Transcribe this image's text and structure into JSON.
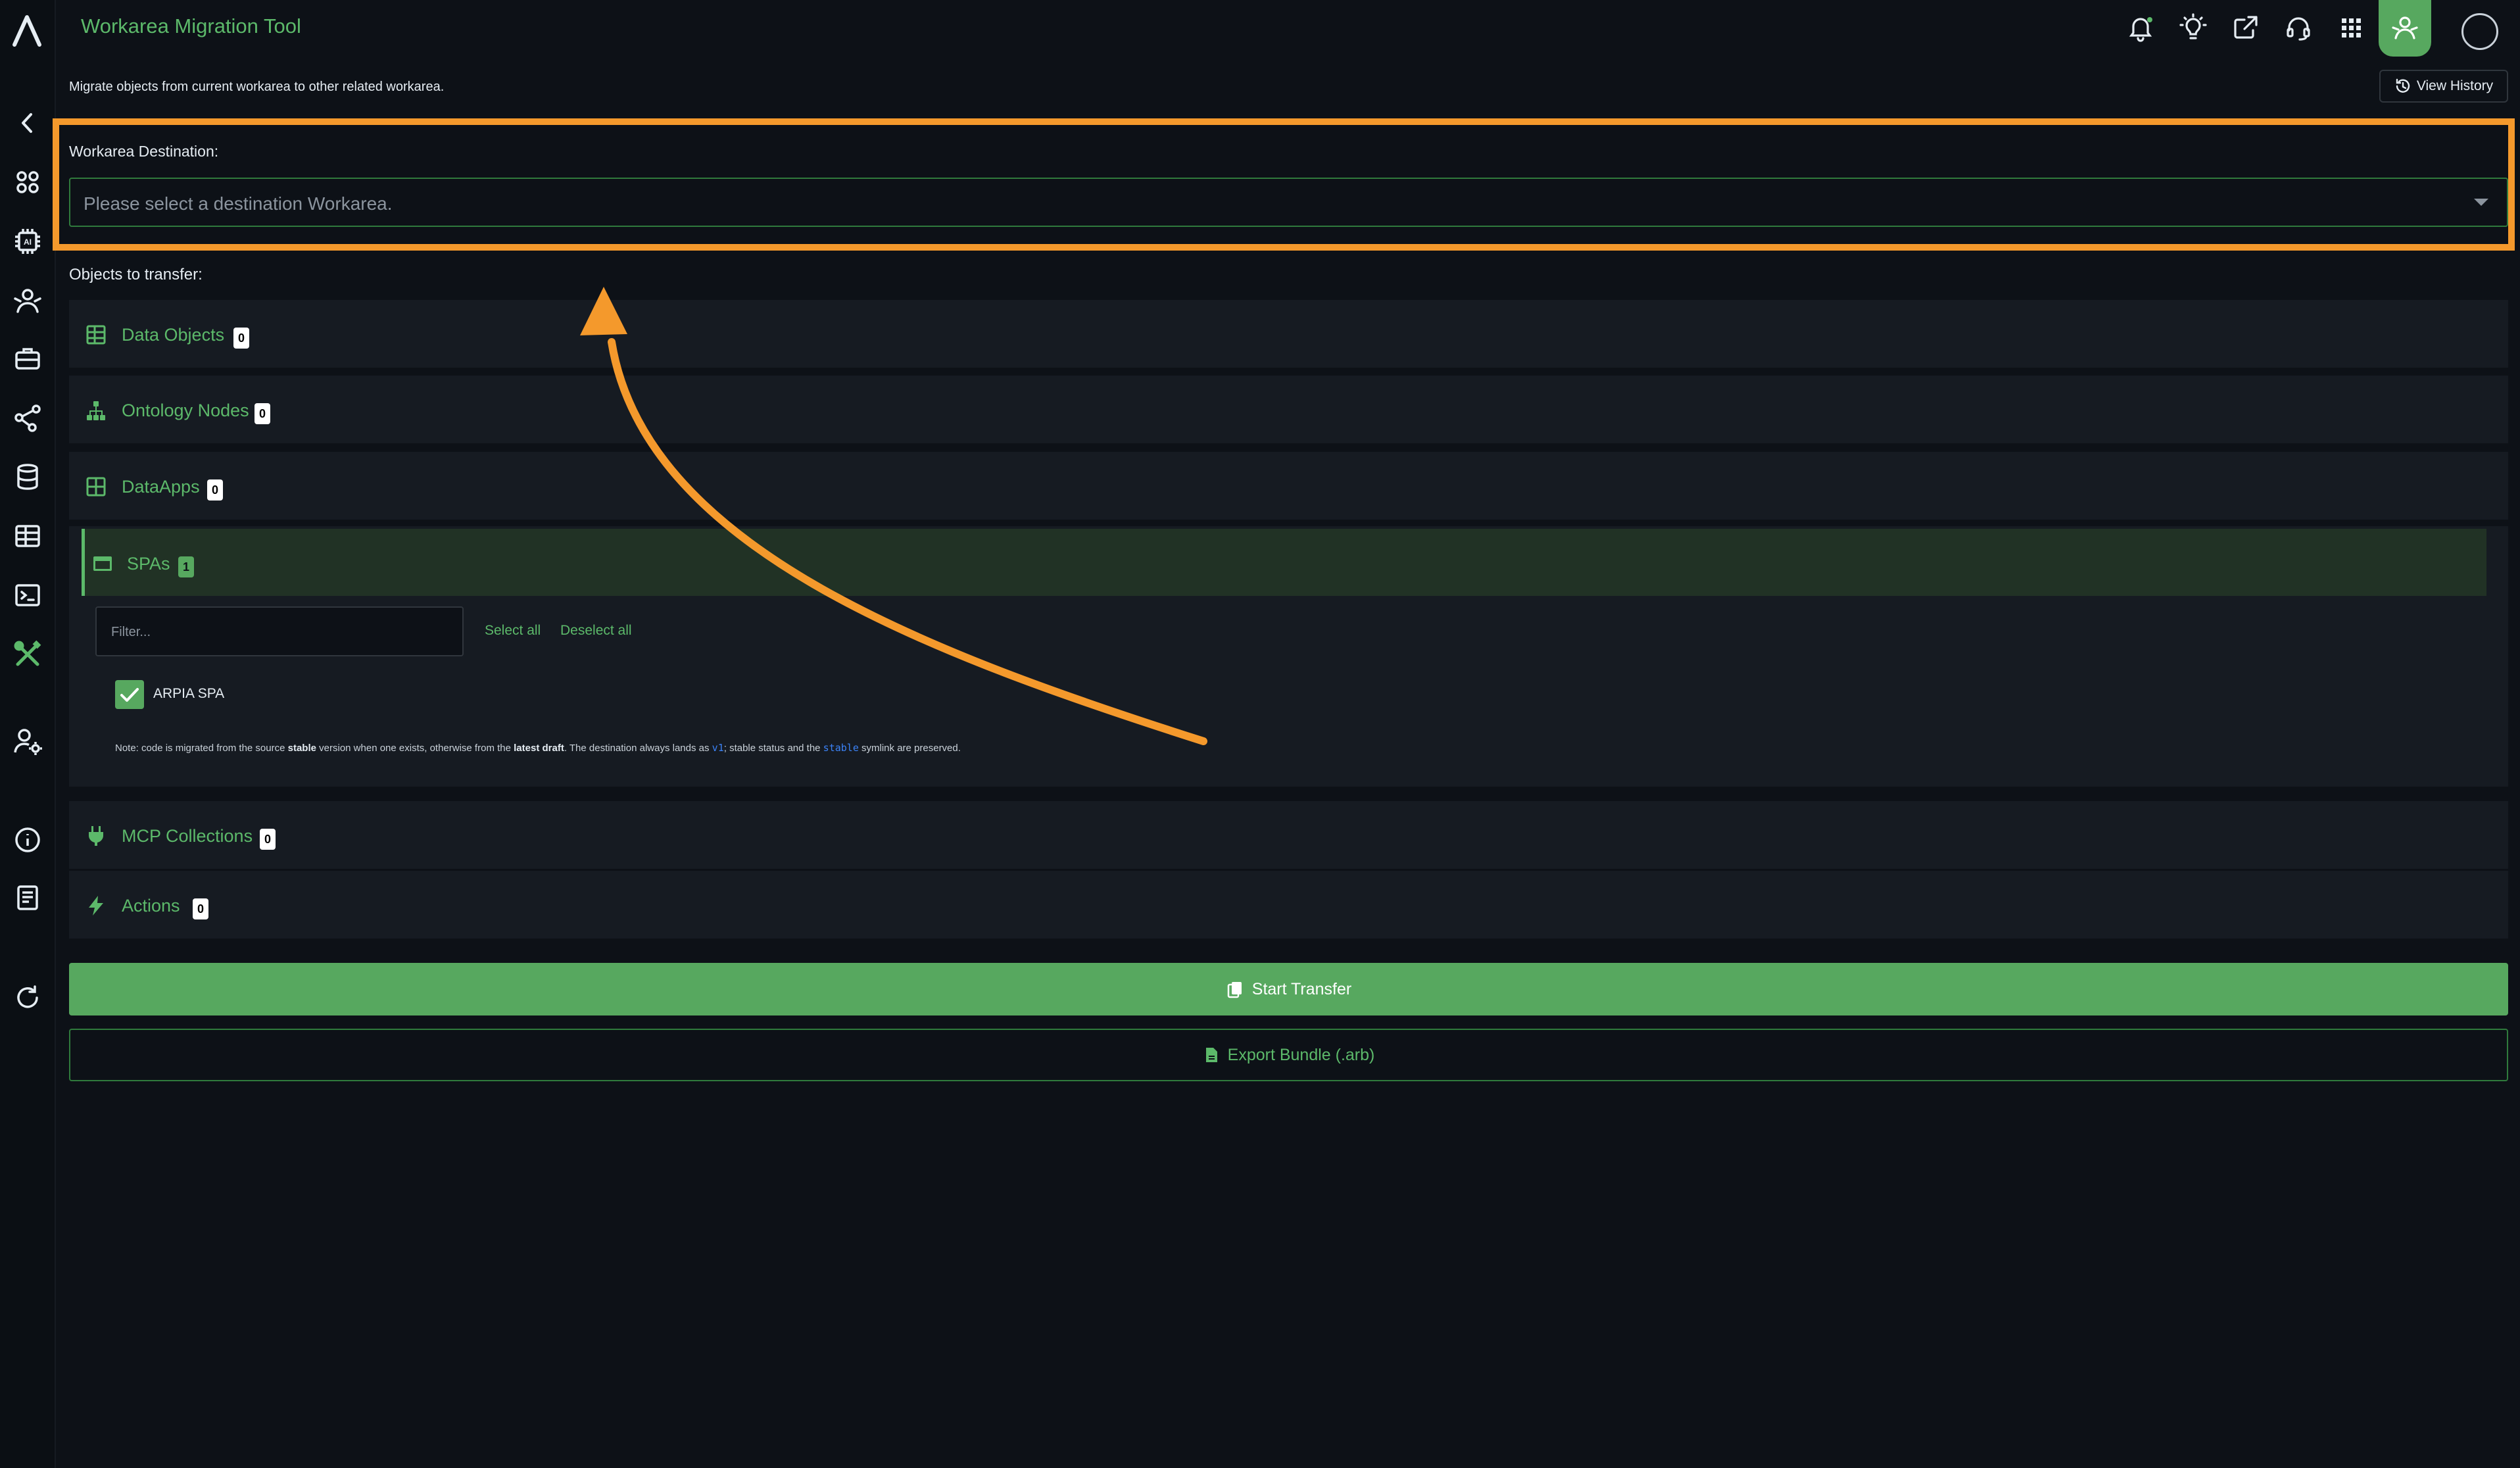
{
  "app": {
    "title": "Workarea Migration Tool"
  },
  "header": {
    "subtitle": "Migrate objects from current workarea to other related workarea.",
    "history_label": "View History"
  },
  "destination": {
    "label": "Workarea Destination:",
    "placeholder": "Please select a destination Workarea."
  },
  "objects": {
    "label": "Objects to transfer:",
    "sections": [
      {
        "title": "Data Objects",
        "count": "0"
      },
      {
        "title": "Ontology Nodes",
        "count": "0"
      },
      {
        "title": "DataApps",
        "count": "0"
      },
      {
        "title": "SPAs",
        "count": "1"
      },
      {
        "title": "MCP Collections",
        "count": "0"
      },
      {
        "title": "Actions",
        "count": "0"
      }
    ]
  },
  "spa": {
    "filter_placeholder": "Filter...",
    "select_all": "Select all",
    "deselect_all": "Deselect all",
    "items": [
      {
        "label": "ARPIA SPA",
        "checked": true
      }
    ],
    "note": {
      "p1": "Note: code is migrated from the source ",
      "b1": "stable",
      "p2": " version when one exists, otherwise from the ",
      "b2": "latest draft",
      "p3": ". The destination always lands as ",
      "c1": "v1",
      "p4": "; stable status and the ",
      "c2": "stable",
      "p5": " symlink are preserved."
    }
  },
  "buttons": {
    "start_transfer": "Start Transfer",
    "export_bundle": "Export Bundle (.arb)"
  },
  "colors": {
    "accent": "#57a85f",
    "accent_text": "#5cb96a",
    "highlight": "#f4992c",
    "background": "#0d1117",
    "panel": "#161b22"
  },
  "icons": {
    "sidebar": [
      "logo-icon",
      "back-icon",
      "apps-icon",
      "ai-chip-icon",
      "user-network-icon",
      "toolbox-icon",
      "share-nodes-icon",
      "database-icon",
      "table-icon",
      "terminal-icon",
      "tools-icon",
      "user-settings-icon",
      "info-icon",
      "document-icon",
      "refresh-icon"
    ],
    "topbar": [
      "bell-icon",
      "lightbulb-icon",
      "share-icon",
      "headset-icon",
      "grid-icon",
      "user-icon",
      "avatar"
    ]
  }
}
